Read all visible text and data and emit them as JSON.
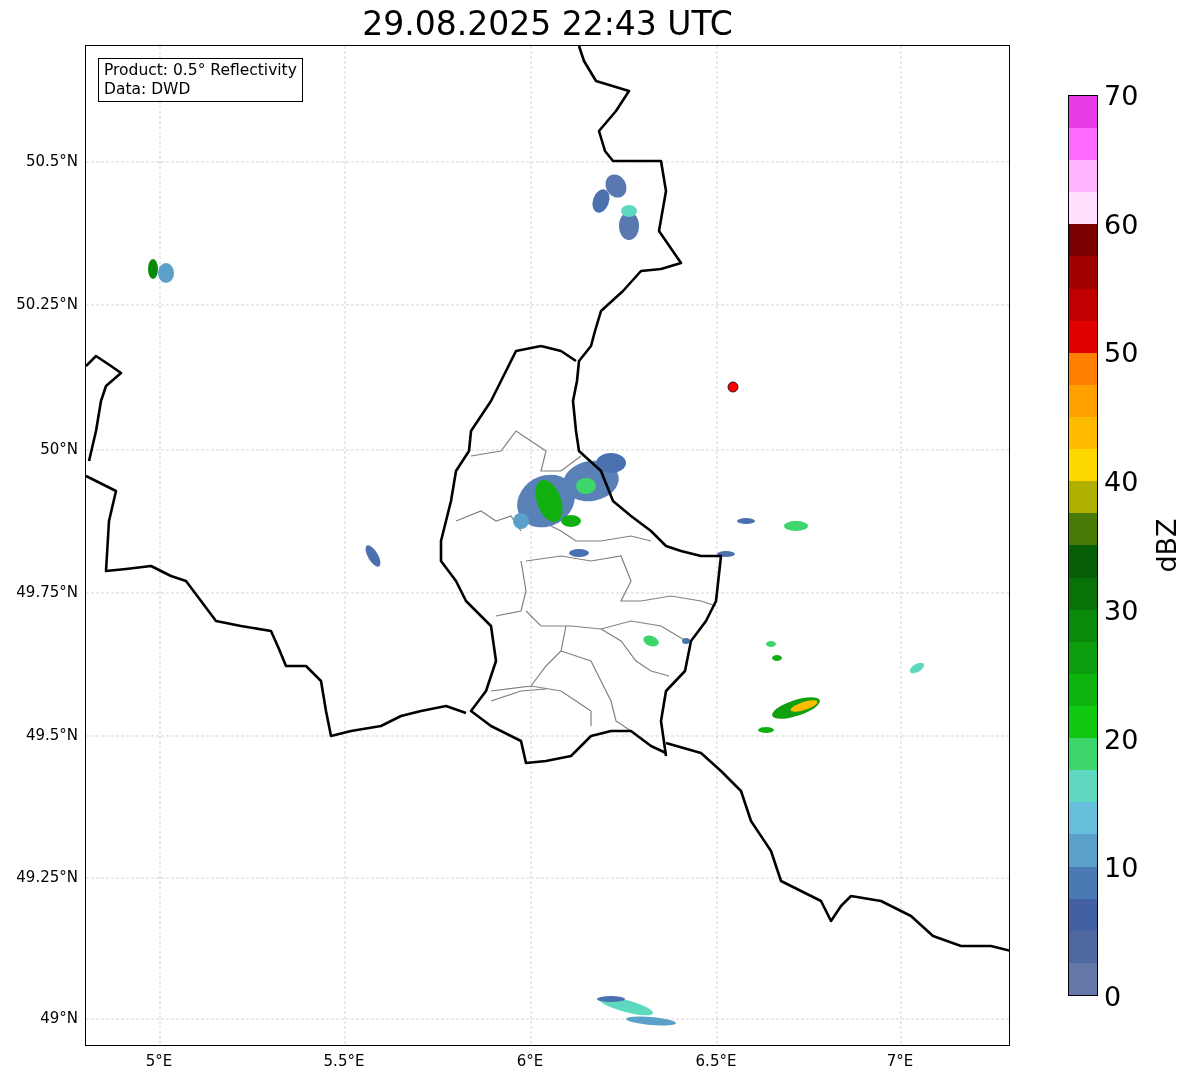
{
  "title": "29.08.2025 22:43 UTC",
  "info_box": {
    "lines": [
      "Product: 0.5° Reflectivity",
      "Data: DWD"
    ]
  },
  "map": {
    "y_ticks": [
      "50.5°N",
      "50.25°N",
      "50°N",
      "49.75°N",
      "49.5°N",
      "49.25°N",
      "49°N"
    ],
    "x_ticks": [
      "5°E",
      "5.5°E",
      "6°E",
      "6.5°E",
      "7°E"
    ]
  },
  "colorbar": {
    "label": "dBZ",
    "ticks": [
      "70",
      "60",
      "50",
      "40",
      "30",
      "20",
      "10",
      "0"
    ],
    "bins": [
      {
        "color": "#6478a8"
      },
      {
        "color": "#5068a0"
      },
      {
        "color": "#4460a4"
      },
      {
        "color": "#4a7ab4"
      },
      {
        "color": "#5aa0c8"
      },
      {
        "color": "#66c0dc"
      },
      {
        "color": "#5fd8c0"
      },
      {
        "color": "#3cd66a"
      },
      {
        "color": "#10c810"
      },
      {
        "color": "#0eb40e"
      },
      {
        "color": "#0c9e0c"
      },
      {
        "color": "#0a8a0a"
      },
      {
        "color": "#087208"
      },
      {
        "color": "#065e06"
      },
      {
        "color": "#487a08"
      },
      {
        "color": "#b0b000"
      },
      {
        "color": "#ffd800"
      },
      {
        "color": "#ffbb00"
      },
      {
        "color": "#ff9f00"
      },
      {
        "color": "#ff7f00"
      },
      {
        "color": "#e00000"
      },
      {
        "color": "#c00000"
      },
      {
        "color": "#a00000"
      },
      {
        "color": "#780000"
      },
      {
        "color": "#ffe0ff"
      },
      {
        "color": "#ffb4ff"
      },
      {
        "color": "#ff6aff"
      },
      {
        "color": "#e93ce9"
      }
    ]
  }
}
